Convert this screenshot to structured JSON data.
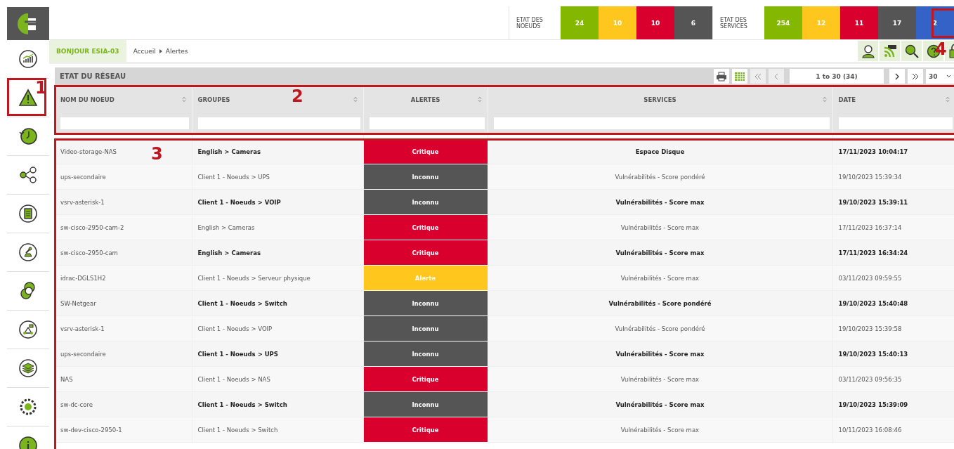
{
  "header": {
    "groups": [
      {
        "label": "ETAT DES NOEUDS",
        "counts": [
          {
            "value": "24",
            "color": "#84b800"
          },
          {
            "value": "10",
            "color": "#ffc61e"
          },
          {
            "value": "10",
            "color": "#d9002e"
          },
          {
            "value": "6",
            "color": "#555555"
          }
        ]
      },
      {
        "label": "ETAT DES SERVICES",
        "counts": [
          {
            "value": "254",
            "color": "#84b800"
          },
          {
            "value": "12",
            "color": "#ffc61e"
          },
          {
            "value": "11",
            "color": "#d9002e"
          },
          {
            "value": "17",
            "color": "#555555"
          },
          {
            "value": "2",
            "color": "#3562c6"
          }
        ]
      }
    ]
  },
  "sidebar": {
    "items": [
      {
        "kind": "chart"
      },
      {
        "kind": "warning"
      },
      {
        "kind": "history"
      },
      {
        "kind": "share"
      },
      {
        "kind": "document"
      },
      {
        "kind": "satellite"
      },
      {
        "kind": "circles"
      },
      {
        "kind": "flow"
      },
      {
        "kind": "layers"
      },
      {
        "kind": "gear"
      },
      {
        "kind": "info"
      }
    ]
  },
  "greeting": "BONJOUR ESIA-03",
  "breadcrumb": [
    "Accueil",
    "Alertes"
  ],
  "toolbar": [
    {
      "kind": "user"
    },
    {
      "kind": "rss"
    },
    {
      "kind": "search"
    },
    {
      "kind": "help"
    },
    {
      "kind": "lock"
    }
  ],
  "panel": {
    "title": "ETAT DU RÉSEAU",
    "pagination": {
      "range": "1 to 30 (34)",
      "page_size": "30"
    }
  },
  "table": {
    "columns": [
      "NOM DU NOEUD",
      "GROUPES",
      "ALERTES",
      "SERVICES",
      "DATE"
    ],
    "rows": [
      {
        "node": "Video-storage-NAS",
        "group": "English > Cameras",
        "alert": "Critique",
        "color": "#d9002e",
        "service": "Espace Disque",
        "date": "17/11/2023 10:04:17",
        "emphasized": true
      },
      {
        "node": "ups-secondaire",
        "group": "Client 1 - Noeuds > UPS",
        "alert": "Inconnu",
        "color": "#555555",
        "service": "Vulnérabilités - Score pondéré",
        "date": "19/10/2023 15:39:34",
        "emphasized": false
      },
      {
        "node": "vsrv-asterisk-1",
        "group": "Client 1 - Noeuds > VOIP",
        "alert": "Inconnu",
        "color": "#555555",
        "service": "Vulnérabilités - Score max",
        "date": "19/10/2023 15:39:11",
        "emphasized": true
      },
      {
        "node": "sw-cisco-2950-cam-2",
        "group": "English > Cameras",
        "alert": "Critique",
        "color": "#d9002e",
        "service": "Vulnérabilités - Score max",
        "date": "17/11/2023 16:37:14",
        "emphasized": false
      },
      {
        "node": "sw-cisco-2950-cam",
        "group": "English > Cameras",
        "alert": "Critique",
        "color": "#d9002e",
        "service": "Vulnérabilités - Score max",
        "date": "17/11/2023 16:34:24",
        "emphasized": true
      },
      {
        "node": "idrac-DGLS1H2",
        "group": "Client 1 - Noeuds > Serveur physique",
        "alert": "Alerte",
        "color": "#ffc61e",
        "service": "Vulnérabilités - Score max",
        "date": "03/11/2023 09:59:55",
        "emphasized": false
      },
      {
        "node": "SW-Netgear",
        "group": "Client 1 - Noeuds > Switch",
        "alert": "Inconnu",
        "color": "#555555",
        "service": "Vulnérabilités - Score pondéré",
        "date": "19/10/2023 15:40:48",
        "emphasized": true
      },
      {
        "node": "vsrv-asterisk-1",
        "group": "Client 1 - Noeuds > VOIP",
        "alert": "Inconnu",
        "color": "#555555",
        "service": "Vulnérabilités - Score pondéré",
        "date": "19/10/2023 15:39:58",
        "emphasized": false
      },
      {
        "node": "ups-secondaire",
        "group": "Client 1 - Noeuds > UPS",
        "alert": "Inconnu",
        "color": "#555555",
        "service": "Vulnérabilités - Score max",
        "date": "19/10/2023 15:40:13",
        "emphasized": true
      },
      {
        "node": "NAS",
        "group": "Client 1 - Noeuds > NAS",
        "alert": "Critique",
        "color": "#d9002e",
        "service": "Vulnérabilités - Score max",
        "date": "03/11/2023 09:56:35",
        "emphasized": false
      },
      {
        "node": "sw-dc-core",
        "group": "Client 1 - Noeuds > Switch",
        "alert": "Inconnu",
        "color": "#555555",
        "service": "Vulnérabilités - Score max",
        "date": "19/10/2023 15:39:09",
        "emphasized": true
      },
      {
        "node": "sw-dev-cisco-2950-1",
        "group": "Client 1 - Noeuds > Switch",
        "alert": "Critique",
        "color": "#d9002e",
        "service": "Vulnérabilités - Score max",
        "date": "10/11/2023 16:08:46",
        "emphasized": false
      }
    ]
  },
  "annotations": [
    "1",
    "2",
    "3",
    "4"
  ]
}
